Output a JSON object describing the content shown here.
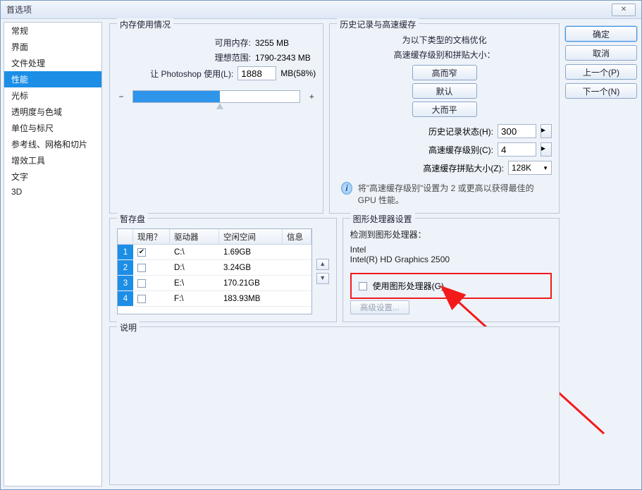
{
  "title": "首选项",
  "sidebar": [
    "常规",
    "界面",
    "文件处理",
    "性能",
    "光标",
    "透明度与色域",
    "单位与标尺",
    "参考线、网格和切片",
    "增效工具",
    "文字",
    "3D"
  ],
  "selectedIndex": 3,
  "buttons": {
    "ok": "确定",
    "cancel": "取消",
    "prev": "上一个(P)",
    "next": "下一个(N)"
  },
  "memory": {
    "legend": "内存使用情况",
    "availLabel": "可用内存:",
    "availVal": "3255 MB",
    "idealLabel": "理想范围:",
    "idealVal": "1790-2343 MB",
    "letLabel": "让 Photoshop 使用(L):",
    "letVal": "1888",
    "letPct": "MB(58%)"
  },
  "history": {
    "legend": "历史记录与高速缓存",
    "desc1": "为以下类型的文档优化",
    "desc2": "高速缓存级别和拼贴大小：",
    "b1": "高而窄",
    "b2": "默认",
    "b3": "大而平",
    "k1": "历史记录状态(H):",
    "v1": "300",
    "k2": "高速缓存级别(C):",
    "v2": "4",
    "k3": "高速缓存拼贴大小(Z):",
    "v3": "128K",
    "note": "将\"高速缓存级别\"设置为 2 或更高以获得最佳的 GPU 性能。"
  },
  "scratch": {
    "legend": "暂存盘",
    "headers": {
      "active": "现用？",
      "drive": "驱动器",
      "free": "空闲空间",
      "info": "信息"
    },
    "rows": [
      {
        "n": "1",
        "active": true,
        "drive": "C:\\",
        "free": "1.69GB"
      },
      {
        "n": "2",
        "active": false,
        "drive": "D:\\",
        "free": "3.24GB"
      },
      {
        "n": "3",
        "active": false,
        "drive": "E:\\",
        "free": "170.21GB"
      },
      {
        "n": "4",
        "active": false,
        "drive": "F:\\",
        "free": "183.93MB"
      }
    ]
  },
  "gpu": {
    "legend": "图形处理器设置",
    "detectedLabel": "检测到图形处理器：",
    "vendor": "Intel",
    "model": "Intel(R) HD Graphics 2500",
    "useGpu": "使用图形处理器(G)",
    "adv": "高级设置..."
  },
  "descLegend": "说明"
}
